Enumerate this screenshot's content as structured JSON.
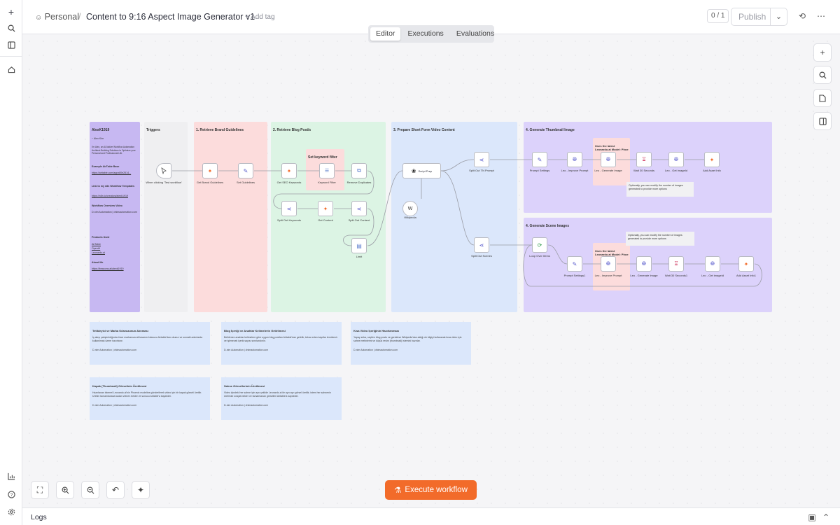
{
  "breadcrumb": {
    "project": "Personal",
    "separator": "/",
    "workflow_title": "Content to 9:16 Aspect Image Generator v1",
    "add_tag": "+ Add tag"
  },
  "header": {
    "version_counter": "0 / 1",
    "publish_label": "Publish"
  },
  "tabs": [
    "Editor",
    "Executions",
    "Evaluations"
  ],
  "sections": {
    "owner": "AlexK1919",
    "triggers": "Triggers",
    "s1": "1. Retrieve Brand Guidelines",
    "s2": "2. Retrieve Blog Post/s",
    "keyword": "Set keyword filter",
    "s3": "3. Prepare Short Form Video Content",
    "s4a": "4. Generate Thumbnail Image",
    "s4b": "4. Generate Scene Images",
    "leo_a": "Uses the latest Leonardo.ai Model: Phoe",
    "leo_b": "Uses the latest Leonardo.ai Model: Phoe"
  },
  "side_note": {
    "author": "~ Alex Kim",
    "intro": "I'm Alex, an AI-Native Workflow Automation Architect Building Solutions to Optimize your Personal and Professional Life.",
    "airtable_h": "Example AirTable Base",
    "airtable_url": "https://airtable.com/appx80e2614...",
    "n8n_h": "Link to my n8n Workflow Templates",
    "n8n_url": "https://n8n.io/creators/alexk1919",
    "video_h": "Workflow Overview Video",
    "video_txt": "D-nim Automation | dnimautomation.com",
    "products_h": "Products Used",
    "p1": "AirTable",
    "p2": "OpenAI",
    "p3": "Leonardo.ai",
    "about_h": "About Me",
    "about_url": "https://beacons.ai/alexk1919"
  },
  "nodes": [
    {
      "id": "trigger",
      "label": "When clicking 'Test workflow'"
    },
    {
      "id": "brand",
      "label": "Get Brand Guidelines"
    },
    {
      "id": "setg",
      "label": "Set Guidelines"
    },
    {
      "id": "seo",
      "label": "Get SEO Keywords"
    },
    {
      "id": "kwfilter",
      "label": "Keyword Filter"
    },
    {
      "id": "dedupe",
      "label": "Remove Duplicates"
    },
    {
      "id": "splitkw",
      "label": "Split Out Keywords"
    },
    {
      "id": "getcontent",
      "label": "Get Content"
    },
    {
      "id": "splitcontent",
      "label": "Split Out Content"
    },
    {
      "id": "limit",
      "label": "Limit"
    },
    {
      "id": "script",
      "label": "Script Prep"
    },
    {
      "id": "wiki",
      "label": "Wikipedia"
    },
    {
      "id": "splittn",
      "label": "Split Out TN Prompt"
    },
    {
      "id": "splitscenes",
      "label": "Split Out Scenes"
    },
    {
      "id": "ps",
      "label": "Prompt Settings"
    },
    {
      "id": "leo1",
      "label": "Leo - Improve Prompt"
    },
    {
      "id": "leo2",
      "label": "Leo - Generate Image"
    },
    {
      "id": "wait1",
      "label": "Wait 30 Seconds"
    },
    {
      "id": "leo3",
      "label": "Leo - Get imageId"
    },
    {
      "id": "asset1",
      "label": "Add Asset Info"
    },
    {
      "id": "loop",
      "label": "Loop Over Items"
    },
    {
      "id": "ps1",
      "label": "Prompt Settings1"
    },
    {
      "id": "leo4",
      "label": "Leo - Improve Prompt"
    },
    {
      "id": "leo5",
      "label": "Leo - Generate Image"
    },
    {
      "id": "wait2",
      "label": "Wait 30 Seconds1"
    },
    {
      "id": "leo6",
      "label": "Leo - Get imageId"
    },
    {
      "id": "asset2",
      "label": "Add Asset Info1"
    }
  ],
  "hints": {
    "h1": "Optionally, you can modify the number of images generated to provide more options",
    "h2": "Optionally, you can modify the number of images generated to provide more options"
  },
  "notes": [
    {
      "title": "Tetikleyici ve Marka Kılavuzunun Alınması",
      "body": "İş akışı çalıştırıldığında önce markanıza ait tasarım kılavuzu Airtable'dan okunur ve sonraki adımlarda kullanılmak üzere hazırlanır.",
      "footer": "D-nim Automation | dnimautomation.com"
    },
    {
      "title": "Blog İçeriği ve Anahtar Kelimelerin Getirilmesi",
      "body": "Belirlenen anahtar kelimelere göre uygun blog postları Airtable'dan getirilir, tekrar eden kayıtlar temizlenir ve işlenecek içerik sayısı sınırlandırılır.",
      "footer": "D-nim Automation | dnimautomation.com"
    },
    {
      "title": "Kısa Video İçeriğinin Hazırlanması",
      "body": "Yapay zeka, seçilen blog postu ve gerekirse Wikipedia'dan aldığı ek bilgiyi kullanarak kısa video için sahne metinlerini ve küçük resim (thumbnail) istemini hazırlar.",
      "footer": "D-nim Automation | dnimautomation.com"
    },
    {
      "title": "Kapak (Thumbnail) Görselinin Üretilmesi",
      "body": "Hazırlanan istemel Leonardo.ai'nin Phoenix modeline gönderilerek video için bir kapak görseli üretilir. Üretim tamamlanana kadar izlenen bekler ve sonucu Airtable'a kaydeder.",
      "footer": "D-nim Automation | dnimautomation.com"
    },
    {
      "title": "Sahne Görsellerinin Üretilmesi",
      "body": "Video içindeki her sahne için ayrı şekilde Leonardo.ai ile ayrı ayrı görsel üretilir, istem her sahnenin üretimini sırayla bekler ve tamamlanan görselleri Airtable'a kaydeder.",
      "footer": "D-nim Automation | dnimautomation.com"
    }
  ],
  "execute_label": "Execute workflow",
  "logs_label": "Logs",
  "colors": {
    "accent": "#f26b2a",
    "pink": "#fcdcdc",
    "green": "#dcf4e4",
    "blue": "#dbe7fb",
    "purple": "#dcd2fb",
    "lavender": "#c7b8f2"
  }
}
